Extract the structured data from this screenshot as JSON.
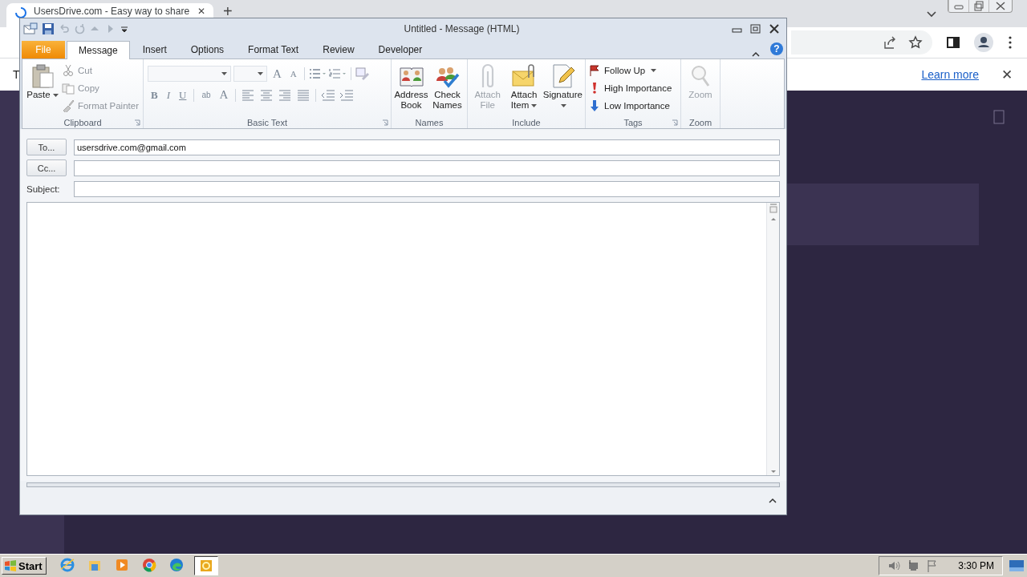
{
  "browser": {
    "tab": {
      "title": "UsersDrive.com - Easy way to share",
      "close": "✕"
    },
    "new_tab": "+",
    "infobar": {
      "text": "T",
      "link": "Learn more",
      "close": "✕"
    }
  },
  "outlook": {
    "title": "Untitled - Message (HTML)",
    "help": "?",
    "tabs": [
      {
        "label": "File",
        "kind": "file",
        "selected": false
      },
      {
        "label": "Message",
        "kind": "tab",
        "selected": true
      },
      {
        "label": "Insert",
        "kind": "tab",
        "selected": false
      },
      {
        "label": "Options",
        "kind": "tab",
        "selected": false
      },
      {
        "label": "Format Text",
        "kind": "tab",
        "selected": false
      },
      {
        "label": "Review",
        "kind": "tab",
        "selected": false
      },
      {
        "label": "Developer",
        "kind": "tab",
        "selected": false
      }
    ],
    "groups": [
      {
        "kind": "clipboard",
        "label": "Clipboard",
        "launcher": true,
        "items": [
          {
            "label": "Paste",
            "kind": "large",
            "disabled": false,
            "dropdown": true
          },
          {
            "label": "Cut",
            "kind": "small",
            "disabled": true,
            "dropdown": false
          },
          {
            "label": "Copy",
            "kind": "small",
            "disabled": true,
            "dropdown": false
          },
          {
            "label": "Format Painter",
            "kind": "small",
            "disabled": true,
            "dropdown": false
          }
        ]
      },
      {
        "kind": "font",
        "label": "Basic Text",
        "launcher": true,
        "disabled": true,
        "grow": "A",
        "shrink": "A",
        "bold": "B",
        "italic": "I",
        "underline": "U",
        "highlight": "ab",
        "font_color": "A"
      },
      {
        "kind": "names",
        "label": "Names",
        "launcher": false,
        "items": [
          {
            "label": "Address Book",
            "kind": "large",
            "disabled": false,
            "dropdown": false
          },
          {
            "label": "Check Names",
            "kind": "large",
            "disabled": false,
            "dropdown": false
          }
        ]
      },
      {
        "kind": "include",
        "label": "Include",
        "launcher": false,
        "items": [
          {
            "label": "Attach File",
            "kind": "large",
            "disabled": true,
            "dropdown": false
          },
          {
            "label": "Attach Item",
            "kind": "large",
            "disabled": false,
            "dropdown": true
          },
          {
            "label": "Signature",
            "kind": "large",
            "disabled": false,
            "dropdown": true
          }
        ]
      },
      {
        "kind": "tags",
        "label": "Tags",
        "launcher": true,
        "items": [
          {
            "label": "Follow Up",
            "kind": "small",
            "disabled": false,
            "dropdown": true
          },
          {
            "label": "High Importance",
            "kind": "small",
            "disabled": false,
            "dropdown": false
          },
          {
            "label": "Low Importance",
            "kind": "small",
            "disabled": false,
            "dropdown": false
          }
        ]
      },
      {
        "kind": "zoom",
        "label": "Zoom",
        "launcher": false,
        "items": [
          {
            "label": "Zoom",
            "kind": "large",
            "disabled": true,
            "dropdown": false
          }
        ]
      }
    ],
    "to": {
      "button": "To...",
      "value": "usersdrive.com@gmail.com"
    },
    "cc": {
      "button": "Cc..."
    },
    "subject": {
      "label": "Subject:"
    }
  },
  "taskbar": {
    "start": "Start",
    "apps": [
      {
        "selected": false
      },
      {
        "selected": false
      },
      {
        "selected": false
      },
      {
        "selected": false
      },
      {
        "selected": false
      },
      {
        "selected": true
      }
    ],
    "time": "3:30 PM"
  }
}
